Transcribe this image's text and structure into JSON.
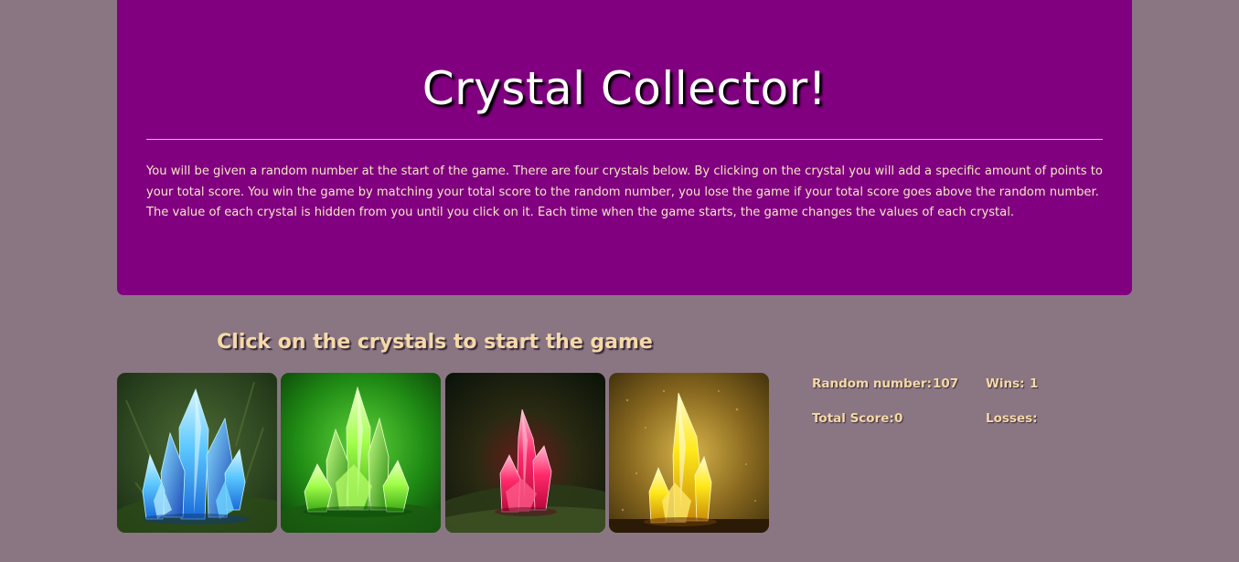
{
  "header": {
    "title": "Crystal Collector!",
    "instructions": "You will be given a random number at the start of the game. There are four crystals below. By clicking on the crystal you will add a specific amount of points to your total score. You win the game by matching your total score to the random number, you lose the game if your total score goes above the random number. The value of each crystal is hidden from you until you click on it. Each time when the game starts, the game changes the values of each crystal."
  },
  "game": {
    "prompt": "Click on the crystals to start the game",
    "crystals": [
      {
        "name": "blue-crystal",
        "color": "#4fc8ff",
        "background": "#2f4a1f"
      },
      {
        "name": "green-crystal",
        "color": "#7cff3a",
        "background": "#1f7a12"
      },
      {
        "name": "red-crystal",
        "color": "#ff1a5a",
        "background": "#1a2410"
      },
      {
        "name": "yellow-crystal",
        "color": "#ffe81a",
        "background": "#5a4410"
      }
    ]
  },
  "stats": {
    "random_number_label": "Random number:",
    "random_number_value": "107",
    "wins_label": "Wins:",
    "wins_value": "1",
    "total_score_label": "Total Score:",
    "total_score_value": "0",
    "losses_label": "Losses:",
    "losses_value": ""
  },
  "colors": {
    "page_background": "#8a7682",
    "jumbotron_background": "#800080",
    "accent_text": "#f5d9a8"
  }
}
